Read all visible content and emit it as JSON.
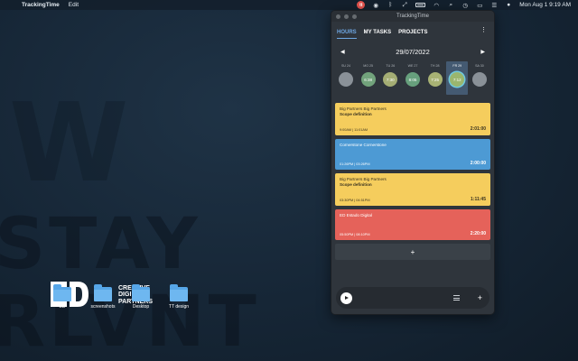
{
  "menubar": {
    "app_name": "TrackingTime",
    "menu_edit": "Edit",
    "datetime": "Mon Aug 1  9:19 AM"
  },
  "wallpaper": {
    "stay": "STAY",
    "rlvnt": "RLVNT"
  },
  "desktop": {
    "logo_cdp": [
      "CREATIVE",
      "DIGI",
      "PARTNERS"
    ],
    "icons": [
      {
        "label": "ED"
      },
      {
        "label": "screenshots"
      },
      {
        "label": "Desktop"
      },
      {
        "label": "TT design"
      }
    ]
  },
  "window": {
    "title": "TrackingTime",
    "tabs": [
      {
        "label": "HOURS",
        "active": true
      },
      {
        "label": "MY TASKS",
        "active": false
      },
      {
        "label": "PROJECTS",
        "active": false
      }
    ],
    "date": "29/07/2022",
    "days": [
      {
        "label": "SU 24",
        "value": "",
        "color": "#8a9198"
      },
      {
        "label": "MO 25",
        "value": "6:38",
        "color": "#72a37c"
      },
      {
        "label": "TU 26",
        "value": "7:30",
        "color": "#a4ad74"
      },
      {
        "label": "WE 27",
        "value": "8:05",
        "color": "#67a07d"
      },
      {
        "label": "TH 28",
        "value": "7:25",
        "color": "#a8b274"
      },
      {
        "label": "FR 29",
        "value": "7:12",
        "color": "#9ab66e",
        "selected": true
      },
      {
        "label": "SA 30",
        "value": "",
        "color": "#8a9198"
      }
    ],
    "entries": [
      {
        "line1": "Big Partners Big Partners",
        "line2": "Scope definition",
        "times": "9:00AM  |  11:01AM",
        "duration": "2:01:00",
        "bg": "#f5cd5d",
        "fg": "#3a3320"
      },
      {
        "line1": "Cornerstone Cornerstone",
        "line2": "",
        "times": "01:26PM  |  03:26PM",
        "duration": "2:00:00",
        "bg": "#4d9ad4",
        "fg": "#ffffff"
      },
      {
        "line1": "Big Partners Big Partners",
        "line2": "Scope definition",
        "times": "03:30PM  |  04:51PM",
        "duration": "1:11:45",
        "bg": "#f5cd5d",
        "fg": "#3a3320"
      },
      {
        "line1": "ED Estado Digital",
        "line2": "",
        "times": "05:50PM  |  08:10PM",
        "duration": "2:20:00",
        "bg": "#e5625a",
        "fg": "#ffffff"
      }
    ],
    "add_label": "+",
    "timer_add": "+"
  }
}
